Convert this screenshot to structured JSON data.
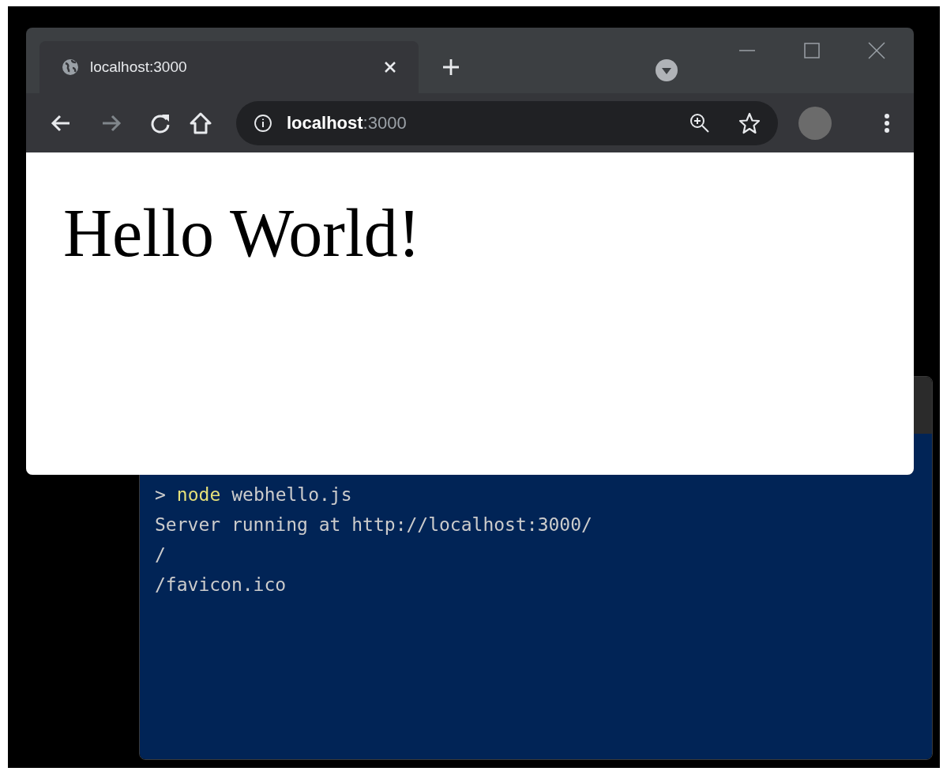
{
  "browser": {
    "tab": {
      "title": "localhost:3000",
      "selected": true
    },
    "address": {
      "host": "localhost",
      "port": ":3000"
    },
    "page": {
      "heading": "Hello World!"
    }
  },
  "terminal": {
    "lines": [
      [
        {
          "kind": "prompt",
          "text": ">"
        },
        {
          "kind": "command",
          "text": "node"
        },
        {
          "kind": "plain",
          "text": "webhello.js"
        }
      ],
      [
        {
          "kind": "plain",
          "text": "Server running at http://localhost:3000/"
        }
      ],
      [
        {
          "kind": "plain",
          "text": "/"
        }
      ],
      [
        {
          "kind": "plain",
          "text": "/favicon.ico"
        }
      ]
    ]
  }
}
